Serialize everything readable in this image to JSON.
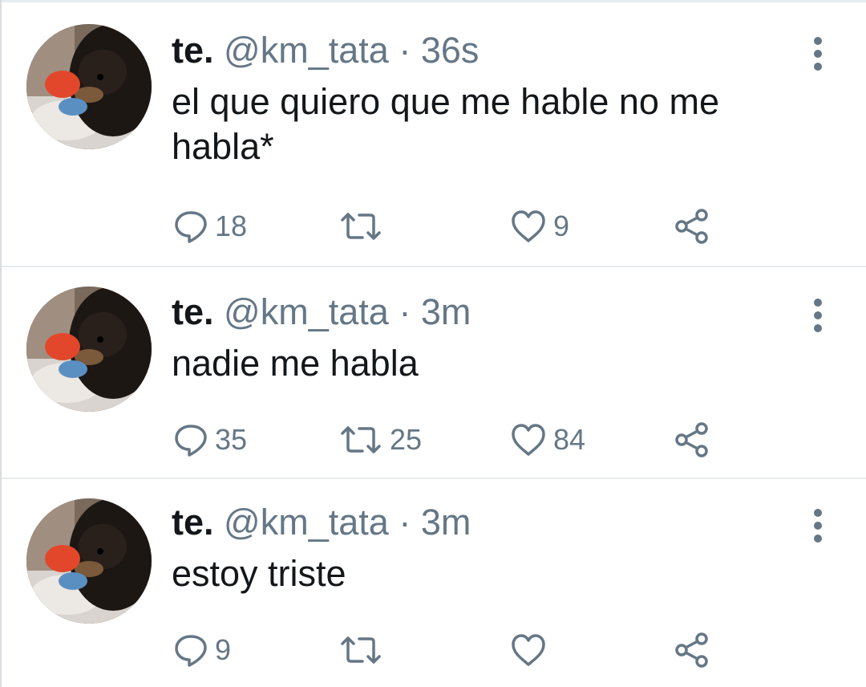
{
  "colors": {
    "text": "#14171a",
    "secondary": "#657786",
    "divider": "#e6ecf0"
  },
  "tweets": [
    {
      "display_name": "te.",
      "handle": "@km_tata",
      "separator": "·",
      "time": "36s",
      "text": "el que quiero que me hable no me habla*",
      "replies": "18",
      "retweets": "",
      "likes": "9"
    },
    {
      "display_name": "te.",
      "handle": "@km_tata",
      "separator": "·",
      "time": "3m",
      "text": "nadie me habla",
      "replies": "35",
      "retweets": "25",
      "likes": "84"
    },
    {
      "display_name": "te.",
      "handle": "@km_tata",
      "separator": "·",
      "time": "3m",
      "text": "estoy triste",
      "replies": "9",
      "retweets": "",
      "likes": ""
    }
  ],
  "icons": {
    "reply": "reply-icon",
    "retweet": "retweet-icon",
    "like": "like-icon",
    "share": "share-icon",
    "more": "more-options-icon"
  }
}
